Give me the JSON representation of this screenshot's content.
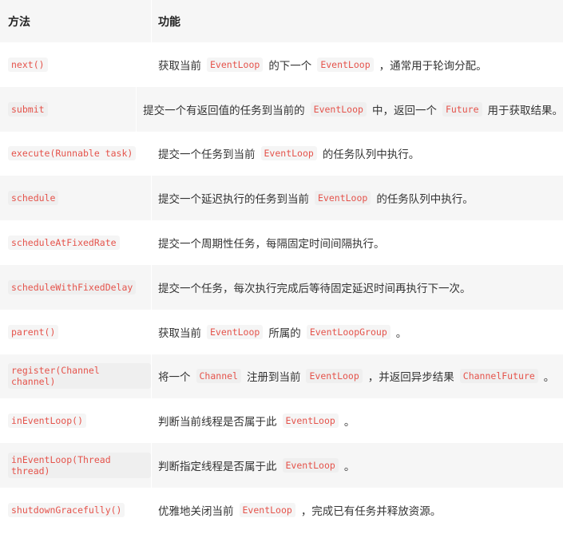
{
  "header": {
    "method": "方法",
    "function": "功能"
  },
  "rows": [
    {
      "method": "next()",
      "desc": [
        {
          "t": "获取当前"
        },
        {
          "c": "EventLoop"
        },
        {
          "t": "的下一个"
        },
        {
          "c": "EventLoop"
        },
        {
          "t": "，通常用于轮询分配。"
        }
      ]
    },
    {
      "method": "submit",
      "desc": [
        {
          "t": "提交一个有返回值的任务到当前的"
        },
        {
          "c": "EventLoop"
        },
        {
          "t": "中，返回一个"
        },
        {
          "c": "Future"
        },
        {
          "t": "用于获取结果。"
        }
      ]
    },
    {
      "method": "execute(Runnable task)",
      "desc": [
        {
          "t": "提交一个任务到当前"
        },
        {
          "c": "EventLoop"
        },
        {
          "t": "的任务队列中执行。"
        }
      ]
    },
    {
      "method": "schedule",
      "desc": [
        {
          "t": "提交一个延迟执行的任务到当前"
        },
        {
          "c": "EventLoop"
        },
        {
          "t": "的任务队列中执行。"
        }
      ]
    },
    {
      "method": "scheduleAtFixedRate",
      "desc": [
        {
          "t": "提交一个周期性任务，每隔固定时间间隔执行。"
        }
      ]
    },
    {
      "method": "scheduleWithFixedDelay",
      "desc": [
        {
          "t": "提交一个任务，每次执行完成后等待固定延迟时间再执行下一次。"
        }
      ]
    },
    {
      "method": "parent()",
      "desc": [
        {
          "t": "获取当前"
        },
        {
          "c": "EventLoop"
        },
        {
          "t": "所属的"
        },
        {
          "c": "EventLoopGroup"
        },
        {
          "t": "。"
        }
      ]
    },
    {
      "method": "register(Channel channel)",
      "desc": [
        {
          "t": "将一个"
        },
        {
          "c": "Channel"
        },
        {
          "t": "注册到当前"
        },
        {
          "c": "EventLoop"
        },
        {
          "t": "，并返回异步结果"
        },
        {
          "c": "ChannelFuture"
        },
        {
          "t": "。"
        }
      ]
    },
    {
      "method": "inEventLoop()",
      "desc": [
        {
          "t": "判断当前线程是否属于此"
        },
        {
          "c": "EventLoop"
        },
        {
          "t": "。"
        }
      ]
    },
    {
      "method": "inEventLoop(Thread thread)",
      "desc": [
        {
          "t": "判断指定线程是否属于此"
        },
        {
          "c": "EventLoop"
        },
        {
          "t": "。"
        }
      ]
    },
    {
      "method": "shutdownGracefully()",
      "desc": [
        {
          "t": "优雅地关闭当前"
        },
        {
          "c": "EventLoop"
        },
        {
          "t": "，完成已有任务并释放资源。"
        }
      ]
    }
  ]
}
